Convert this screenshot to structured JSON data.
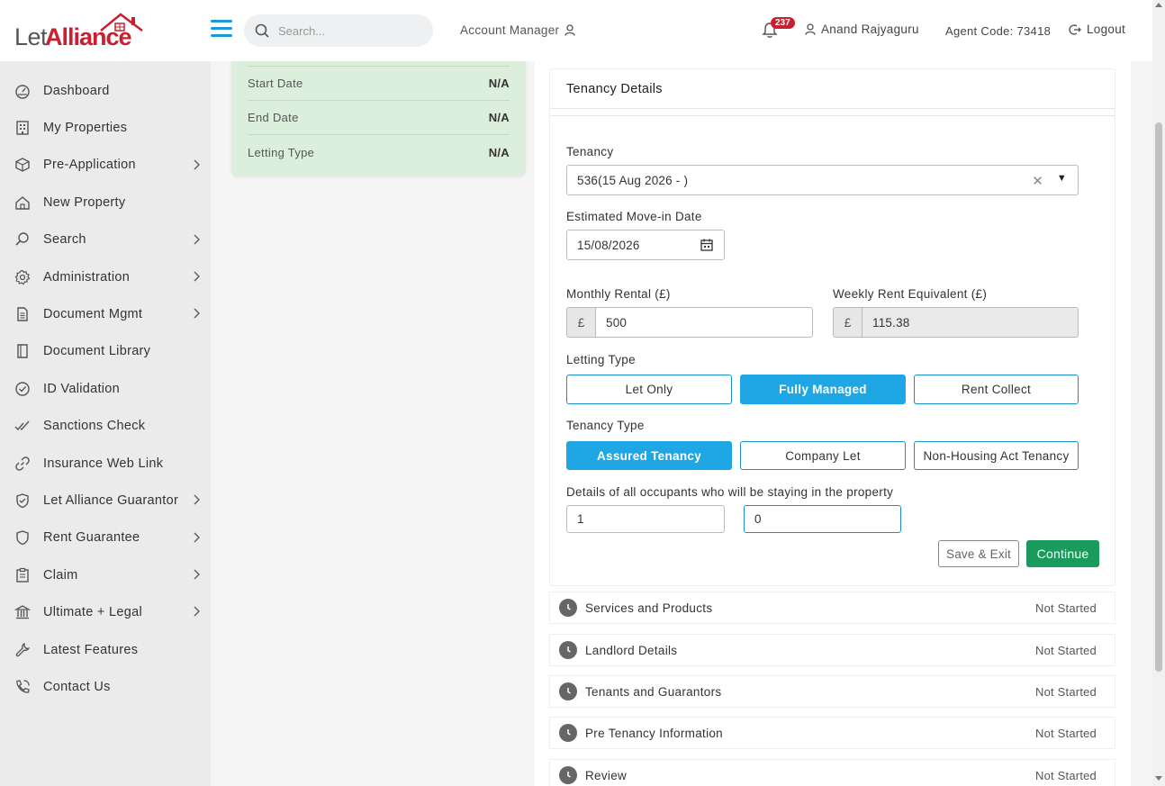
{
  "brand": {
    "logo_let": "Let",
    "logo_alliance": "Alliance"
  },
  "header": {
    "search_placeholder": "Search...",
    "account_manager": "Account Manager",
    "notification_count": "237",
    "user_name": "Anand Rajyaguru",
    "agent_code": "Agent Code: 73418",
    "logout": "Logout"
  },
  "sidebar": {
    "items": [
      {
        "label": "Dashboard",
        "icon": "dashboard-icon",
        "has_submenu": false
      },
      {
        "label": "My Properties",
        "icon": "building-icon",
        "has_submenu": false
      },
      {
        "label": "Pre-Application",
        "icon": "box-icon",
        "has_submenu": true
      },
      {
        "label": "New Property",
        "icon": "home-icon",
        "has_submenu": false
      },
      {
        "label": "Search",
        "icon": "search-icon",
        "has_submenu": true
      },
      {
        "label": "Administration",
        "icon": "gear-icon",
        "has_submenu": true
      },
      {
        "label": "Document Mgmt",
        "icon": "document-icon",
        "has_submenu": true
      },
      {
        "label": "Document Library",
        "icon": "book-icon",
        "has_submenu": false
      },
      {
        "label": "ID Validation",
        "icon": "check-circle-icon",
        "has_submenu": false
      },
      {
        "label": "Sanctions Check",
        "icon": "double-check-icon",
        "has_submenu": false
      },
      {
        "label": "Insurance Web Link",
        "icon": "link-icon",
        "has_submenu": false
      },
      {
        "label": "Let Alliance Guarantor",
        "icon": "shield-check-icon",
        "has_submenu": true
      },
      {
        "label": "Rent Guarantee",
        "icon": "shield-icon",
        "has_submenu": true
      },
      {
        "label": "Claim",
        "icon": "clipboard-icon",
        "has_submenu": true
      },
      {
        "label": "Ultimate + Legal",
        "icon": "bank-icon",
        "has_submenu": true
      },
      {
        "label": "Latest Features",
        "icon": "wrench-icon",
        "has_submenu": false
      },
      {
        "label": "Contact Us",
        "icon": "phone-icon",
        "has_submenu": false
      }
    ]
  },
  "summary": {
    "rows": [
      {
        "label": "Start Date",
        "value": "N/A"
      },
      {
        "label": "End Date",
        "value": "N/A"
      },
      {
        "label": "Letting Type",
        "value": "N/A"
      }
    ]
  },
  "form": {
    "title": "Tenancy Details",
    "tenancy_label": "Tenancy",
    "tenancy_value": "536(15 Aug 2026 - )",
    "move_in_label": "Estimated Move-in Date",
    "move_in_value": "15/08/2026",
    "monthly_label": "Monthly Rental (£)",
    "monthly_prefix": "£",
    "monthly_value": "500",
    "weekly_label": "Weekly Rent Equivalent (£)",
    "weekly_prefix": "£",
    "weekly_value": "115.38",
    "letting_type_label": "Letting Type",
    "letting_options": [
      "Let Only",
      "Fully Managed",
      "Rent Collect"
    ],
    "letting_selected": "Fully Managed",
    "tenancy_type_label": "Tenancy Type",
    "tenancy_type_options": [
      "Assured Tenancy",
      "Company Let",
      "Non-Housing Act Tenancy"
    ],
    "tenancy_type_selected": "Assured Tenancy",
    "occupants_label": "Details of all occupants who will be staying in the property",
    "occupants_adults": "1",
    "occupants_children": "0",
    "save_exit": "Save & Exit",
    "continue": "Continue"
  },
  "steps": [
    {
      "name": "Services and Products",
      "status": "Not Started"
    },
    {
      "name": "Landlord Details",
      "status": "Not Started"
    },
    {
      "name": "Tenants and Guarantors",
      "status": "Not Started"
    },
    {
      "name": "Pre Tenancy Information",
      "status": "Not Started"
    },
    {
      "name": "Review",
      "status": "Not Started"
    }
  ],
  "colors": {
    "accent": "#1ea7e4",
    "brand_red": "#c8202f",
    "success": "#1a9a5c",
    "summary_bg": "#dcefdc"
  }
}
